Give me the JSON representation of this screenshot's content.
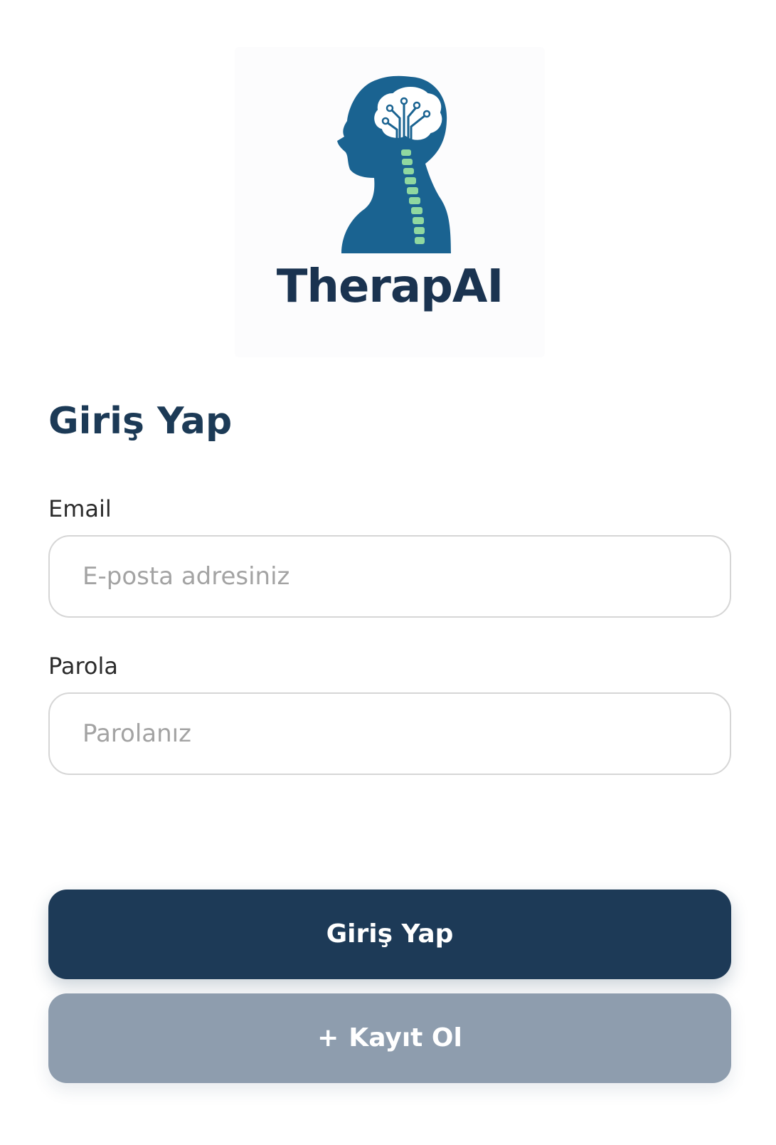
{
  "brand": {
    "name": "TherapAI",
    "logo_icon": "head-brain-spine-icon"
  },
  "login": {
    "title": "Giriş Yap",
    "email": {
      "label": "Email",
      "placeholder": "E-posta adresiniz",
      "value": ""
    },
    "password": {
      "label": "Parola",
      "placeholder": "Parolanız",
      "value": ""
    },
    "submit_label": "Giriş Yap",
    "register": {
      "icon": "+",
      "label": "Kayıt Ol"
    }
  },
  "colors": {
    "primary": "#1d3a57",
    "secondary": "#8e9dae",
    "logo_blue": "#1a6391",
    "spine_green": "#8fd8a0"
  }
}
